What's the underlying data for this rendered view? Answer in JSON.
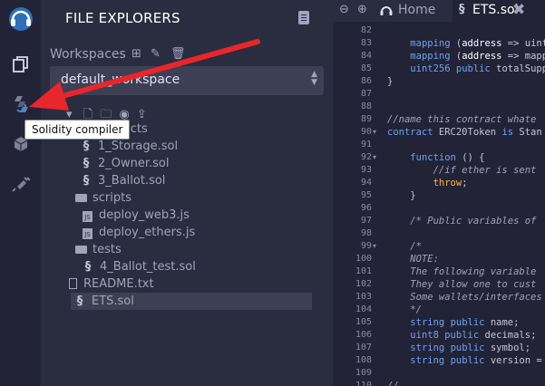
{
  "sidebar": {
    "title": "FILE EXPLORERS",
    "workspaces_label": "Workspaces",
    "workspace_selected": "default_workspace",
    "tree": [
      {
        "label": "contracts",
        "type": "folder"
      },
      {
        "label": "1_Storage.sol",
        "type": "sol"
      },
      {
        "label": "2_Owner.sol",
        "type": "sol"
      },
      {
        "label": "3_Ballot.sol",
        "type": "sol"
      },
      {
        "label": "scripts",
        "type": "folder"
      },
      {
        "label": "deploy_web3.js",
        "type": "js"
      },
      {
        "label": "deploy_ethers.js",
        "type": "js"
      },
      {
        "label": "tests",
        "type": "folder"
      },
      {
        "label": "4_Ballot_test.sol",
        "type": "sol"
      },
      {
        "label": "README.txt",
        "type": "txt"
      },
      {
        "label": "ETS.sol",
        "type": "sol"
      }
    ]
  },
  "tooltip": "Solidity compiler",
  "tabs": {
    "home": "Home",
    "active_file": "ETS.sol"
  },
  "colors": {
    "accent_arrow": "#e8262b",
    "panel_bg": "#2a2c3f",
    "editor_bg": "#222336"
  },
  "icons": [
    "remix-logo-icon",
    "file-explorer-icon",
    "solidity-compiler-icon",
    "deploy-icon",
    "plugin-icon",
    "zoom-out-icon",
    "zoom-in-icon"
  ],
  "editor": {
    "line_numbers": [
      "82",
      "83",
      "84",
      "85",
      "86",
      "87",
      "88",
      "89",
      "90",
      "91",
      "92",
      "93",
      "94",
      "95",
      "96",
      "97",
      "98",
      "99",
      "100",
      "101",
      "102",
      "103",
      "104",
      "105",
      "106",
      "107",
      "108",
      "109",
      "110"
    ],
    "lines": [
      "",
      "    mapping (address => uint",
      "    mapping (address => mapp",
      "    uint256 public totalSupp",
      "}",
      "",
      "",
      "//name this contract whate",
      "contract ERC20Token is Stan",
      "",
      "    function () {",
      "        //if ether is sent",
      "        throw;",
      "    }",
      "",
      "    /* Public variables of",
      "",
      "    /*",
      "    NOTE:",
      "    The following variable",
      "    They allow one to cust",
      "    Some wallets/interfaces",
      "    */",
      "    string public name;",
      "    uint8 public decimals;",
      "    string public symbol;",
      "    string public version =",
      "",
      "//"
    ]
  }
}
